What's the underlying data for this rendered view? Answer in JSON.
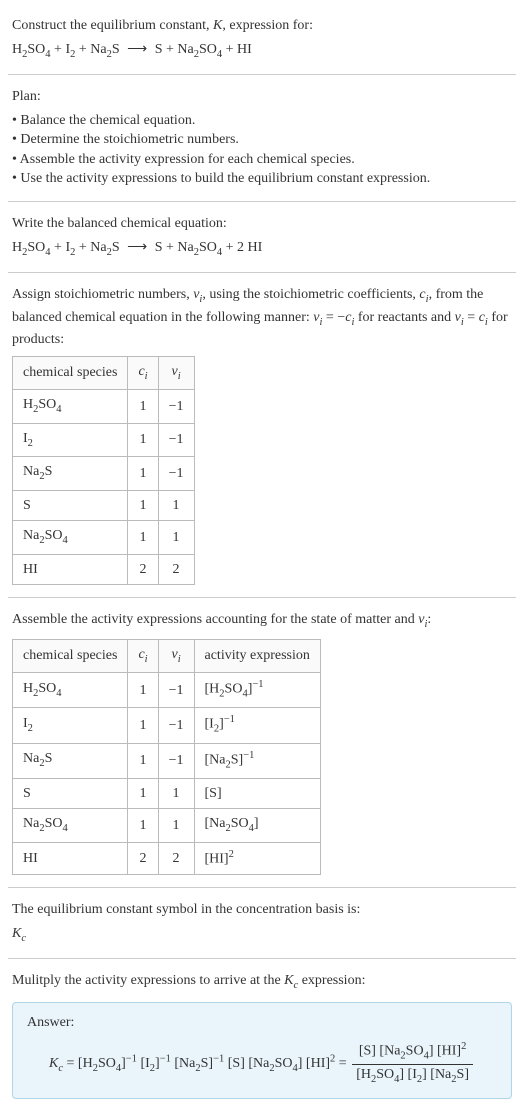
{
  "intro": {
    "line1": "Construct the equilibrium constant, ",
    "K": "K",
    "line1b": ", expression for:"
  },
  "eq1": {
    "r1": "H",
    "r1s": "2",
    "r1b": "SO",
    "r1s2": "4",
    "plus1": " + ",
    "r2": "I",
    "r2s": "2",
    "plus2": " + ",
    "r3": "Na",
    "r3s": "2",
    "r3b": "S",
    "arrow": "⟶",
    "p1": "S + Na",
    "p1s": "2",
    "p1b": "SO",
    "p1s2": "4",
    "plus3": " + HI"
  },
  "plan": {
    "title": "Plan:",
    "b1": "Balance the chemical equation.",
    "b2": "Determine the stoichiometric numbers.",
    "b3": "Assemble the activity expression for each chemical species.",
    "b4": "Use the activity expressions to build the equilibrium constant expression."
  },
  "balanced": {
    "title": "Write the balanced chemical equation:",
    "p_hi": " + 2 HI"
  },
  "stoich": {
    "text1": "Assign stoichiometric numbers, ",
    "nu": "ν",
    "i": "i",
    "text2": ", using the stoichiometric coefficients, ",
    "c": "c",
    "text3": ", from the balanced chemical equation in the following manner: ",
    "eq1": " = −",
    "text4": " for reactants and ",
    "eq2": " = ",
    "text5": " for products:"
  },
  "table1": {
    "h1": "chemical species",
    "h2": "c",
    "h3": "ν",
    "rows": [
      {
        "sp": "H₂SO₄",
        "c": "1",
        "v": "−1"
      },
      {
        "sp": "I₂",
        "c": "1",
        "v": "−1"
      },
      {
        "sp": "Na₂S",
        "c": "1",
        "v": "−1"
      },
      {
        "sp": "S",
        "c": "1",
        "v": "1"
      },
      {
        "sp": "Na₂SO₄",
        "c": "1",
        "v": "1"
      },
      {
        "sp": "HI",
        "c": "2",
        "v": "2"
      }
    ]
  },
  "assemble": {
    "text": "Assemble the activity expressions accounting for the state of matter and ",
    "colon": ":"
  },
  "table2": {
    "h1": "chemical species",
    "h2": "c",
    "h3": "ν",
    "h4": "activity expression"
  },
  "kc_symbol": {
    "text": "The equilibrium constant symbol in the concentration basis is:",
    "K": "K",
    "c": "c"
  },
  "multiply": {
    "text1": "Mulitply the activity expressions to arrive at the ",
    "text2": " expression:"
  },
  "answer": {
    "label": "Answer:"
  }
}
